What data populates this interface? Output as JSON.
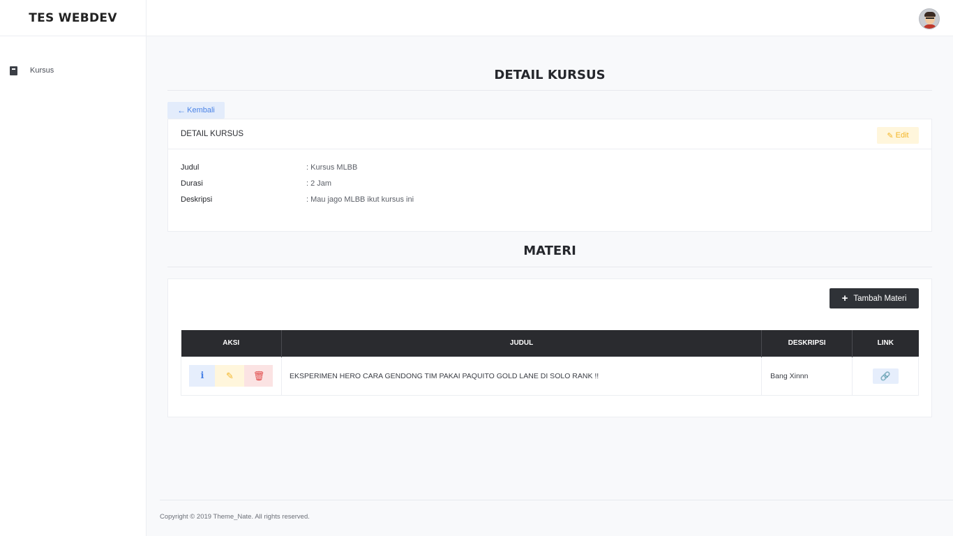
{
  "app": {
    "brand": "TES WEBDEV"
  },
  "sidebar": {
    "items": [
      {
        "label": "Kursus",
        "icon": "book-icon"
      }
    ]
  },
  "topbar": {
    "avatar_icon": "user-avatar"
  },
  "page": {
    "title": "DETAIL KURSUS",
    "back_label": "Kembali",
    "detail_card": {
      "header": "DETAIL KURSUS",
      "edit_label": "Edit",
      "rows": [
        {
          "key": "Judul",
          "value": ": Kursus MLBB"
        },
        {
          "key": "Durasi",
          "value": ": 2 Jam"
        },
        {
          "key": "Deskripsi",
          "value": ": Mau jago MLBB ikut kursus ini"
        }
      ]
    },
    "materi": {
      "title": "MATERI",
      "add_label": "Tambah Materi",
      "columns": [
        "AKSI",
        "JUDUL",
        "DESKRIPSI",
        "LINK"
      ],
      "rows": [
        {
          "judul": "EKSPERIMEN HERO CARA GENDONG TIM PAKAI PAQUITO GOLD LANE DI SOLO RANK !!",
          "deskripsi": "Bang Xinnn"
        }
      ]
    }
  },
  "footer": {
    "text": "Copyright © 2019 Theme_Nate. All rights reserved."
  },
  "colors": {
    "primary": "#4a83e6",
    "warning": "#f3b526",
    "danger": "#e04848",
    "dark": "#2a2b2f"
  }
}
